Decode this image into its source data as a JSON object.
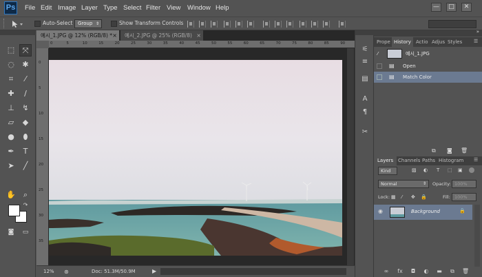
{
  "menu": {
    "app_logo": "Ps",
    "items": [
      "File",
      "Edit",
      "Image",
      "Layer",
      "Type",
      "Select",
      "Filter",
      "View",
      "Window",
      "Help"
    ]
  },
  "window_controls": {
    "minimize": "—",
    "maximize": "□",
    "close": "✕"
  },
  "options": {
    "auto_select_label": "Auto-Select",
    "auto_select_value": "Group",
    "show_transform_label": "Show Transform Controls"
  },
  "documents": {
    "tabs": [
      {
        "title": "예시_1.JPG @ 12% (RGB/8) *",
        "close": "×"
      },
      {
        "title": "예시_2.JPG @ 25% (RGB/8)",
        "close": "×"
      }
    ],
    "ruler_ticks": [
      "0",
      "5",
      "10",
      "15",
      "20",
      "25",
      "30",
      "35",
      "40",
      "45",
      "50",
      "55",
      "60",
      "65",
      "70",
      "75",
      "80",
      "85",
      "90"
    ],
    "vruler_ticks": [
      "0",
      "5",
      "10",
      "15",
      "20",
      "25",
      "30",
      "35"
    ]
  },
  "status": {
    "zoom": "12%",
    "doc_size": "Doc: 51.3M/50.9M",
    "arrow": "▶"
  },
  "top_panels": {
    "tabs": [
      "Prope",
      "History",
      "Actio",
      "Adjus",
      "Styles"
    ],
    "active_tab": "History",
    "snapshot_name": "예시_1.JPG",
    "history_items": [
      {
        "label": "Open",
        "selected": false
      },
      {
        "label": "Match Color",
        "selected": true
      }
    ]
  },
  "layers_panel": {
    "tabs": [
      "Layers",
      "Channels",
      "Paths",
      "Histogram"
    ],
    "active_tab": "Layers",
    "filter_kind": "Kind",
    "blend_mode": "Normal",
    "opacity_label": "Opacity:",
    "opacity_value": "100%",
    "lock_label": "Lock:",
    "fill_label": "Fill:",
    "fill_value": "100%",
    "layers": [
      {
        "name": "Background",
        "visible": true,
        "locked": true
      }
    ]
  },
  "colors": {
    "accent": "#6b7a91",
    "panel": "#535353",
    "dark": "#282828"
  }
}
